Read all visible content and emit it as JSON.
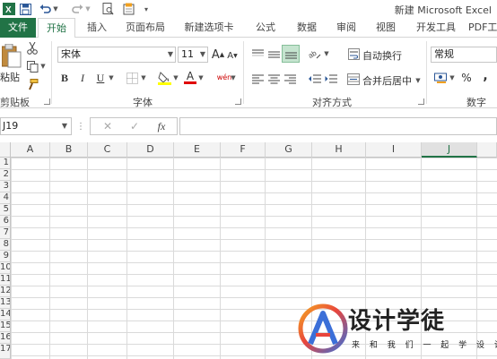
{
  "window": {
    "title": "新建 Microsoft Excel"
  },
  "quick_access": {
    "icons": [
      "excel-logo-icon",
      "save-icon",
      "undo-icon",
      "redo-icon",
      "print-preview-icon",
      "new-icon",
      "customize-icon"
    ]
  },
  "tabs": [
    {
      "label": "文件"
    },
    {
      "label": "开始"
    },
    {
      "label": "插入"
    },
    {
      "label": "页面布局"
    },
    {
      "label": "新建选项卡"
    },
    {
      "label": "公式"
    },
    {
      "label": "数据"
    },
    {
      "label": "审阅"
    },
    {
      "label": "视图"
    },
    {
      "label": "开发工具"
    },
    {
      "label": "PDF工"
    }
  ],
  "ribbon": {
    "clipboard": {
      "label": "剪贴板",
      "paste_label": "粘贴"
    },
    "font": {
      "label": "字体",
      "font_name": "宋体",
      "font_size": "11",
      "bold": "B",
      "italic": "I",
      "underline": "U",
      "grow": "A",
      "shrink": "A",
      "font_color": "A",
      "phonetic": "wén",
      "font_color_hex": "#e00000",
      "fill_color_hex": "#ffff00"
    },
    "alignment": {
      "label": "对齐方式",
      "wrap_text": "自动换行",
      "merge_center": "合并后居中"
    },
    "number": {
      "label": "数字",
      "format": "常规",
      "percent": "%",
      "comma": ","
    }
  },
  "formula_bar": {
    "name_box": "J19",
    "fx": "fx",
    "cancel": "✕",
    "enter": "✓",
    "value": ""
  },
  "grid": {
    "columns": [
      "A",
      "B",
      "C",
      "D",
      "E",
      "F",
      "G",
      "H",
      "I",
      "J"
    ],
    "selected_column": "J",
    "rows": [
      "1",
      "2",
      "3",
      "4",
      "5",
      "6",
      "7",
      "8",
      "9",
      "10",
      "11",
      "12",
      "13",
      "14",
      "15",
      "16",
      "17"
    ]
  },
  "watermark": {
    "title": "设计学徒",
    "subtitle": "来 和 我 们 一 起 学 设 计"
  },
  "colors": {
    "accent": "#217346"
  }
}
